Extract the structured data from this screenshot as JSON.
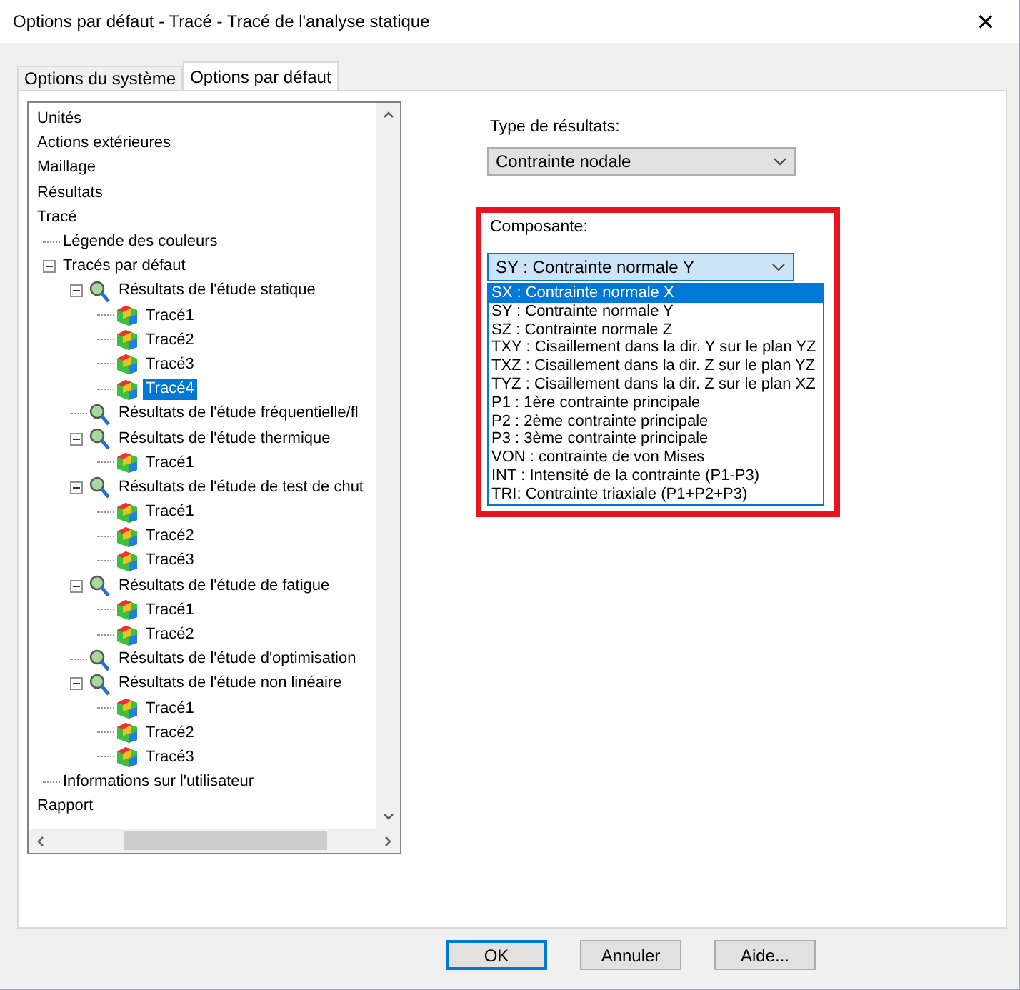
{
  "window": {
    "title": "Options par défaut - Tracé - Tracé de l'analyse statique",
    "close": "✕"
  },
  "tabs": [
    {
      "label": "Options du système",
      "selected": false
    },
    {
      "label": "Options par défaut",
      "selected": true
    }
  ],
  "tree": [
    {
      "label": "Unités",
      "kind": "section",
      "selected": false
    },
    {
      "label": "Actions extérieures",
      "kind": "section",
      "selected": false
    },
    {
      "label": "Maillage",
      "kind": "section",
      "selected": false
    },
    {
      "label": "Résultats",
      "kind": "section",
      "selected": false
    },
    {
      "label": "Tracé",
      "kind": "section",
      "selected": false,
      "children": [
        {
          "label": "Légende des couleurs",
          "kind": "leaf",
          "selected": false
        },
        {
          "label": "Tracés par défaut",
          "kind": "leaf",
          "selected": false,
          "expanded": true,
          "children": [
            {
              "label": "Résultats de l'étude statique",
              "kind": "study",
              "selected": false,
              "expanded": true,
              "children": [
                {
                  "label": "Tracé1",
                  "kind": "plot",
                  "selected": false
                },
                {
                  "label": "Tracé2",
                  "kind": "plot",
                  "selected": false
                },
                {
                  "label": "Tracé3",
                  "kind": "plot",
                  "selected": false
                },
                {
                  "label": "Tracé4",
                  "kind": "plot",
                  "selected": true
                }
              ]
            },
            {
              "label": "Résultats de l'étude fréquentielle/fl",
              "kind": "study",
              "selected": false
            },
            {
              "label": "Résultats de l'étude thermique",
              "kind": "study",
              "selected": false,
              "expanded": true,
              "children": [
                {
                  "label": "Tracé1",
                  "kind": "plot",
                  "selected": false
                }
              ]
            },
            {
              "label": "Résultats de l'étude de test de chut",
              "kind": "study",
              "selected": false,
              "expanded": true,
              "children": [
                {
                  "label": "Tracé1",
                  "kind": "plot",
                  "selected": false
                },
                {
                  "label": "Tracé2",
                  "kind": "plot",
                  "selected": false
                },
                {
                  "label": "Tracé3",
                  "kind": "plot",
                  "selected": false
                }
              ]
            },
            {
              "label": "Résultats de l'étude de fatigue",
              "kind": "study",
              "selected": false,
              "expanded": true,
              "children": [
                {
                  "label": "Tracé1",
                  "kind": "plot",
                  "selected": false
                },
                {
                  "label": "Tracé2",
                  "kind": "plot",
                  "selected": false
                }
              ]
            },
            {
              "label": "Résultats de l'étude d'optimisation",
              "kind": "study",
              "selected": false
            },
            {
              "label": "Résultats de l'étude non linéaire",
              "kind": "study",
              "selected": false,
              "expanded": true,
              "children": [
                {
                  "label": "Tracé1",
                  "kind": "plot",
                  "selected": false
                },
                {
                  "label": "Tracé2",
                  "kind": "plot",
                  "selected": false
                },
                {
                  "label": "Tracé3",
                  "kind": "plot",
                  "selected": false
                }
              ]
            }
          ]
        },
        {
          "label": "Informations sur l'utilisateur",
          "kind": "leaf",
          "selected": false
        }
      ]
    },
    {
      "label": "Rapport",
      "kind": "section",
      "selected": false
    }
  ],
  "result_type": {
    "label": "Type de résultats:",
    "value": "Contrainte nodale"
  },
  "component": {
    "label": "Composante:",
    "value": "SY : Contrainte normale Y",
    "options": [
      {
        "label": "SX : Contrainte normale X",
        "highlighted": true
      },
      {
        "label": "SY : Contrainte normale Y",
        "highlighted": false
      },
      {
        "label": "SZ : Contrainte normale Z",
        "highlighted": false
      },
      {
        "label": "TXY : Cisaillement dans la dir. Y sur le plan YZ",
        "highlighted": false
      },
      {
        "label": "TXZ : Cisaillement dans la dir. Z sur le plan YZ",
        "highlighted": false
      },
      {
        "label": "TYZ : Cisaillement dans la dir. Z sur le plan XZ",
        "highlighted": false
      },
      {
        "label": "P1 : 1ère contrainte principale",
        "highlighted": false
      },
      {
        "label": "P2 : 2ème contrainte principale",
        "highlighted": false
      },
      {
        "label": "P3 : 3ème contrainte principale",
        "highlighted": false
      },
      {
        "label": "VON : contrainte de von Mises",
        "highlighted": false
      },
      {
        "label": "INT : Intensité de la contrainte (P1-P3)",
        "highlighted": false
      },
      {
        "label": "TRI: Contrainte triaxiale (P1+P2+P3)",
        "highlighted": false
      }
    ]
  },
  "buttons": [
    {
      "label": "OK",
      "focused": true
    },
    {
      "label": "Annuler",
      "focused": false
    },
    {
      "label": "Aide...",
      "focused": false
    }
  ]
}
